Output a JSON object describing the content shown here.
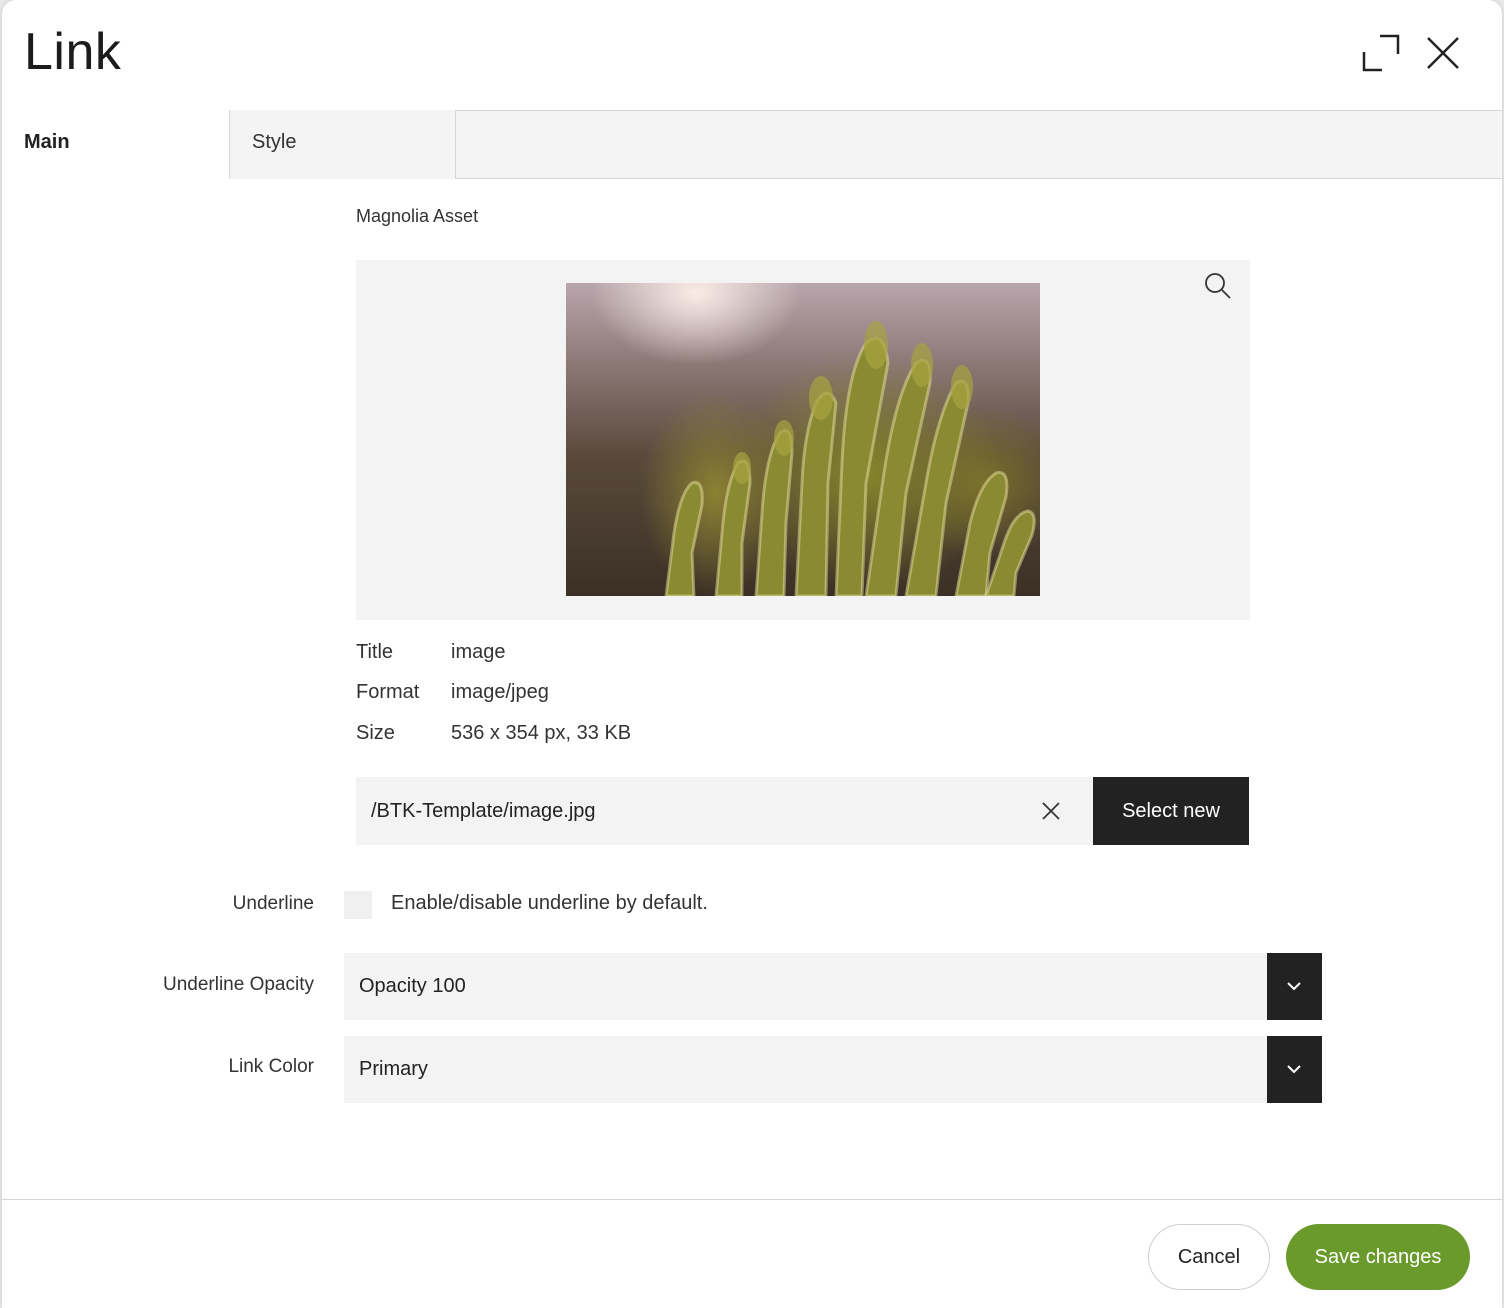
{
  "dialog": {
    "title": "Link",
    "expand_icon": "expand-icon",
    "close_icon": "close-icon"
  },
  "tabs": [
    {
      "label": "Main",
      "active": true
    },
    {
      "label": "Style",
      "active": false
    }
  ],
  "asset": {
    "label": "Magnolia Asset",
    "zoom_icon": "search-icon",
    "meta": [
      {
        "key": "Title",
        "value": "image"
      },
      {
        "key": "Format",
        "value": "image/jpeg"
      },
      {
        "key": "Size",
        "value": "536 x 354 px, 33 KB"
      }
    ],
    "path": "/BTK-Template/image.jpg",
    "clear_icon": "close-icon",
    "select_new_label": "Select new"
  },
  "underline": {
    "label": "Underline",
    "checked": false,
    "description": "Enable/disable underline by default."
  },
  "underline_opacity": {
    "label": "Underline Opacity",
    "value": "Opacity 100",
    "icon": "chevron-down-icon"
  },
  "link_color": {
    "label": "Link Color",
    "value": "Primary",
    "icon": "chevron-down-icon"
  },
  "footer": {
    "cancel_label": "Cancel",
    "save_label": "Save changes",
    "save_color": "#6b9a2c"
  }
}
